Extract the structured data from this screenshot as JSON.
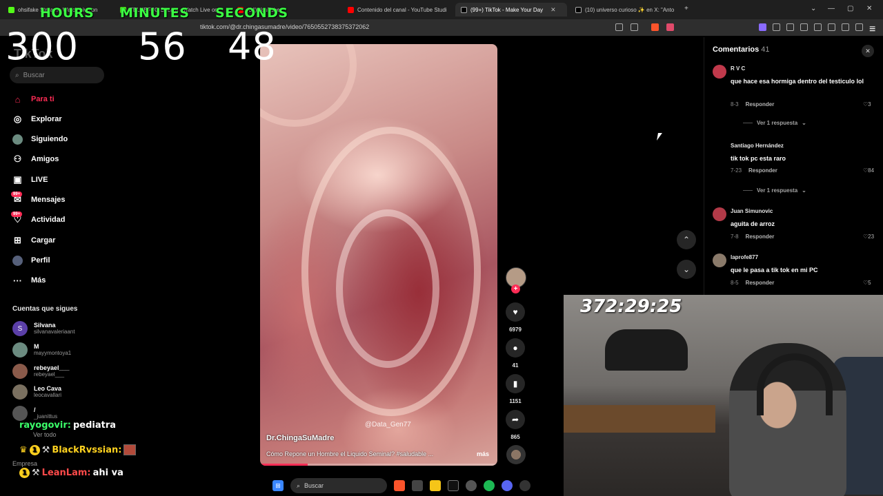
{
  "browser": {
    "tabs": [
      {
        "label": "ohsifake Stream - Watch Live on",
        "color": "#53fc18"
      },
      {
        "label": "TELUEFSO Stream - Watch Live on",
        "color": "#53fc18"
      },
      {
        "label": "(84) YouTube",
        "color": "#ff0000"
      },
      {
        "label": "Contenido del canal - YouTube Studi",
        "color": "#ff0000"
      },
      {
        "label": "(99+) TikTok - Make Your Day",
        "color": "#000000"
      },
      {
        "label": "(10) universo curioso ✨ en X: \"Anto",
        "color": "#000000"
      }
    ],
    "url": "tiktok.com/@dr.chingasumadre/video/7650552738375372062"
  },
  "overlay_timer": {
    "hours_label": "HOURS",
    "minutes_label": "MINUTES",
    "seconds_label": "SECONDS",
    "hours": "300",
    "minutes": "56",
    "seconds": "48"
  },
  "sidebar": {
    "logo": "TikTok",
    "search_placeholder": "Buscar",
    "nav": [
      {
        "label": "Para ti",
        "icon": "home-icon"
      },
      {
        "label": "Explorar",
        "icon": "compass-icon"
      },
      {
        "label": "Siguiendo",
        "icon": "following-icon"
      },
      {
        "label": "Amigos",
        "icon": "friends-icon"
      },
      {
        "label": "LIVE",
        "icon": "live-icon"
      },
      {
        "label": "Mensajes",
        "icon": "messages-icon",
        "badge": "99+"
      },
      {
        "label": "Actividad",
        "icon": "activity-icon",
        "badge": "99+"
      },
      {
        "label": "Cargar",
        "icon": "upload-icon"
      },
      {
        "label": "Perfil",
        "icon": "profile-icon"
      },
      {
        "label": "Más",
        "icon": "more-icon"
      }
    ],
    "following_title": "Cuentas que sigues",
    "following": [
      {
        "name": "Silvana",
        "handle": "silvanavaleriaant",
        "initial": "S",
        "color": "#5b3fa8"
      },
      {
        "name": "M",
        "handle": "mayymontoya1",
        "initial": "",
        "color": "#6b8b80"
      },
      {
        "name": "rebeyael___",
        "handle": "rebeyael___",
        "initial": "",
        "color": "#8a5a4a"
      },
      {
        "name": "Leo Cava",
        "handle": "leocavallari",
        "initial": "",
        "color": "#7a7060"
      },
      {
        "name": "/",
        "handle": "_juanittus",
        "initial": "",
        "color": "#555555"
      }
    ],
    "see_more": "Ver todo",
    "company": "Empresa"
  },
  "chat": [
    {
      "user": "rayogovir:",
      "message": "pediatra",
      "user_color": "#3bff6a",
      "badge": ""
    },
    {
      "user": "BlackRvssian:",
      "message": "",
      "user_color": "#ffd21f",
      "badge": "1"
    },
    {
      "user": "LeanLam:",
      "message": "ahi va",
      "user_color": "#ff4a4a",
      "badge": "1"
    }
  ],
  "video": {
    "author": "Dr.ChingaSuMadre",
    "description": "Cómo Repone un Hombre el Liquido Seminal? #saludable ...",
    "more": "más",
    "watermark": "@Data_Gen77",
    "progress": 0.2
  },
  "actions": {
    "likes": "6979",
    "comments": "41",
    "saves": "1151",
    "shares": "865"
  },
  "comments_panel": {
    "title": "Comentarios",
    "count": "41",
    "reply_label": "Responder",
    "comments": [
      {
        "user": "R V C",
        "text": "que hace esa hormiga dentro del testiculo lol",
        "date": "8-3",
        "likes": "3",
        "replies": "Ver 1 respuesta",
        "avatar_color": "#c0394b"
      },
      {
        "user": "Santiago Hernández",
        "text": "tik tok pc esta raro",
        "date": "7-23",
        "likes": "84",
        "replies": "Ver 1 respuesta",
        "avatar_color": "#000000"
      },
      {
        "user": "Juan Simunovic",
        "text": "aguita de arroz",
        "date": "7-8",
        "likes": "23",
        "replies": "",
        "avatar_color": "#b23a48"
      },
      {
        "user": "laprofe877",
        "text": "que le pasa a tik tok en mi PC",
        "date": "8-5",
        "likes": "5",
        "replies": "",
        "avatar_color": "#8a7a6a"
      }
    ]
  },
  "webcam": {
    "timer": "372:29:25"
  },
  "taskbar": {
    "search_placeholder": "Buscar"
  }
}
